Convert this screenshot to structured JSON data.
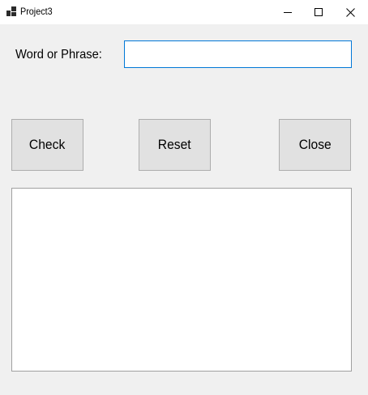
{
  "window": {
    "title": "Project3",
    "icon": "app-window-icon",
    "controls": {
      "minimize_icon": "minimize-icon",
      "maximize_icon": "maximize-icon",
      "close_icon": "close-icon"
    }
  },
  "form": {
    "input_label": "Word or Phrase:",
    "input_value": "",
    "buttons": {
      "check_label": "Check",
      "reset_label": "Reset",
      "close_label": "Close"
    },
    "output_text": ""
  },
  "colors": {
    "background": "#f0f0f0",
    "titlebar": "#ffffff",
    "button_face": "#e1e1e1",
    "button_border": "#adadad",
    "focus_border": "#0078d7"
  }
}
